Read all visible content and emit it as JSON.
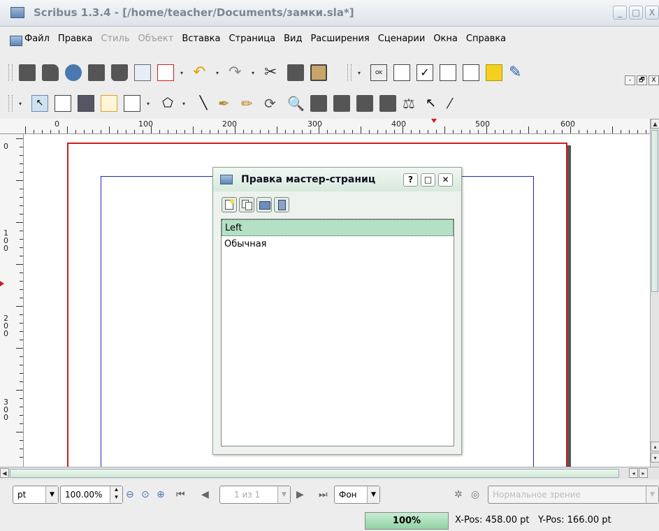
{
  "window": {
    "title": "Scribus 1.3.4 - [/home/teacher/Documents/замки.sla*]",
    "minimize": "_",
    "maximize": "□",
    "close": "X"
  },
  "menu": [
    "Файл",
    "Правка",
    "Стиль",
    "Объект",
    "Вставка",
    "Страница",
    "Вид",
    "Расширения",
    "Сценарии",
    "Окна",
    "Справка"
  ],
  "menu_disabled": [
    "Стиль",
    "Объект"
  ],
  "mdi_controls": [
    "-",
    "🗗",
    "X"
  ],
  "ruler": {
    "top_marks": [
      "0",
      "100",
      "200",
      "300",
      "400",
      "500",
      "600"
    ],
    "left_marks": [
      "0",
      "100",
      "200",
      "300"
    ]
  },
  "master_dialog": {
    "title": "Правка мастер-страниц",
    "help": "?",
    "maximize": "□",
    "close": "✕",
    "items": [
      "Left",
      "Обычная"
    ],
    "selected": 0
  },
  "bottombar": {
    "unit": "pt",
    "zoom_value": "100.00%",
    "page_indicator": "1 из 1",
    "layer": "Фон",
    "view_mode": "Нормальное зрение"
  },
  "status": {
    "zoom": "100%",
    "xpos": "X-Pos: 458.00 pt",
    "ypos": "Y-Pos: 166.00 pt"
  },
  "colors": {
    "page_border": "#d01c1c",
    "margin_guides": "#1c2bb0",
    "dialog_selection": "#b4e1c6"
  }
}
